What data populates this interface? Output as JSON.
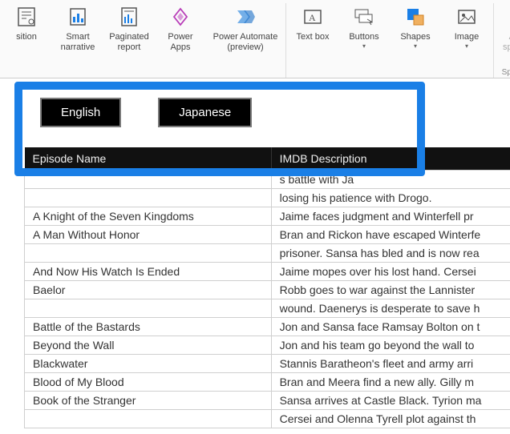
{
  "ribbon": {
    "groups": [
      {
        "caption": "",
        "items": [
          {
            "id": "decomposition",
            "label": "sition",
            "icon": "decomp"
          },
          {
            "id": "smart-narrative",
            "label": "Smart narrative",
            "icon": "narrative"
          },
          {
            "id": "paginated-report",
            "label": "Paginated report",
            "icon": "report"
          },
          {
            "id": "power-apps",
            "label": "Power Apps",
            "icon": "papps"
          },
          {
            "id": "power-automate",
            "label": "Power Automate (preview)",
            "icon": "pautomate",
            "wide": true
          }
        ]
      },
      {
        "caption": "",
        "items": [
          {
            "id": "text-box",
            "label": "Text box",
            "icon": "textbox"
          },
          {
            "id": "buttons",
            "label": "Buttons",
            "icon": "buttons",
            "dropdown": true
          },
          {
            "id": "shapes",
            "label": "Shapes",
            "icon": "shapes",
            "dropdown": true
          },
          {
            "id": "image",
            "label": "Image",
            "icon": "image",
            "dropdown": true
          }
        ]
      },
      {
        "caption": "Sparklines",
        "items": [
          {
            "id": "add-sparkline",
            "label": "Add a sparkline",
            "icon": "sparkline",
            "disabled": true
          }
        ]
      }
    ]
  },
  "language_buttons": [
    {
      "id": "english",
      "label": "English"
    },
    {
      "id": "japanese",
      "label": "Japanese"
    }
  ],
  "table": {
    "headers": [
      "Episode Name",
      "IMDB Description"
    ],
    "rows": [
      {
        "ep": "",
        "desc": "s battle with Ja"
      },
      {
        "ep": "",
        "desc": "losing his patience with Drogo."
      },
      {
        "ep": "A Knight of the Seven Kingdoms",
        "desc": "Jaime faces judgment and Winterfell pr"
      },
      {
        "ep": "A Man Without Honor",
        "desc": "Bran and Rickon have escaped Winterfe"
      },
      {
        "ep": "",
        "desc": "prisoner. Sansa has bled and is now rea"
      },
      {
        "ep": "And Now His Watch Is Ended",
        "desc": "Jaime mopes over his lost hand. Cersei"
      },
      {
        "ep": "Baelor",
        "desc": "Robb goes to war against the Lannister"
      },
      {
        "ep": "",
        "desc": "wound. Daenerys is desperate to save h"
      },
      {
        "ep": "Battle of the Bastards",
        "desc": "Jon and Sansa face Ramsay Bolton on t"
      },
      {
        "ep": "Beyond the Wall",
        "desc": "Jon and his team go beyond the wall to"
      },
      {
        "ep": "Blackwater",
        "desc": "Stannis Baratheon's fleet and army arri"
      },
      {
        "ep": "Blood of My Blood",
        "desc": "Bran and Meera find a new ally. Gilly m"
      },
      {
        "ep": "Book of the Stranger",
        "desc": "Sansa arrives at Castle Black. Tyrion ma"
      },
      {
        "ep": "",
        "desc": "Cersei and Olenna Tyrell plot against th"
      }
    ]
  }
}
